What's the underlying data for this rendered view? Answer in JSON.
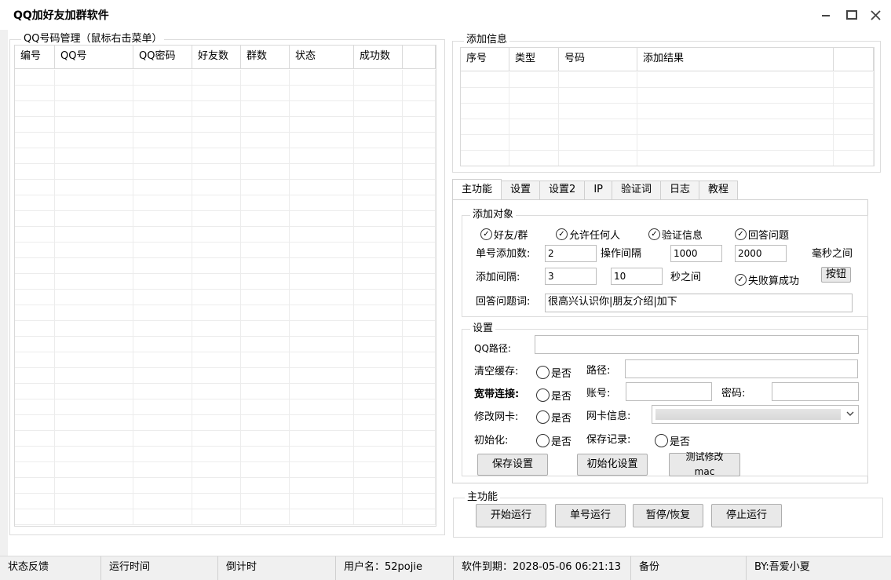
{
  "window": {
    "title": "QQ加好友加群软件"
  },
  "qq_group": {
    "title": "QQ号码管理（鼠标右击菜单）",
    "columns": [
      "编号",
      "QQ号",
      "QQ密码",
      "好友数",
      "群数",
      "状态",
      "成功数"
    ]
  },
  "add_info": {
    "title": "添加信息",
    "columns": [
      "序号",
      "类型",
      "号码",
      "添加结果"
    ]
  },
  "tabs": [
    "主功能",
    "设置",
    "设置2",
    "IP",
    "验证词",
    "日志",
    "教程"
  ],
  "add_target": {
    "title": "添加对象",
    "opt_friend_group": "好友/群",
    "opt_allow_anyone": "允许任何人",
    "opt_verify": "验证信息",
    "opt_answer": "回答问题",
    "single_add_label": "单号添加数:",
    "single_add_value": "2",
    "op_interval_label": "操作间隔",
    "op_interval_min": "1000",
    "op_interval_max": "2000",
    "ms_label": "毫秒之间",
    "add_interval_label": "添加间隔:",
    "add_interval_min": "3",
    "add_interval_max": "10",
    "sec_label": "秒之间",
    "fail_success": "失败算成功",
    "button_label": "按钮",
    "answer_label": "回答问题词:",
    "answer_value": "很高兴认识你|朋友介绍|加下"
  },
  "settings": {
    "title": "设置",
    "qq_path_label": "QQ路径:",
    "clear_cache_label": "清空缓存:",
    "broadband_label": "宽带连接:",
    "modify_nic_label": "修改网卡:",
    "init_label": "初始化:",
    "yes_no": "是否",
    "path_label": "路径:",
    "account_label": "账号:",
    "password_label": "密码:",
    "nic_info_label": "网卡信息:",
    "save_record_label": "保存记录:",
    "save_btn": "保存设置",
    "init_btn": "初始化设置",
    "test_mac_btn_line1": "测试修改",
    "test_mac_btn_line2": "mac"
  },
  "main_func": {
    "title": "主功能",
    "start": "开始运行",
    "single": "单号运行",
    "pause": "暂停/恢复",
    "stop": "停止运行"
  },
  "status_bar": {
    "feedback": "状态反馈",
    "run_time": "运行时间",
    "countdown": "倒计时",
    "username": "用户名：52pojie",
    "expiry": "软件到期：2028-05-06 06:21:13",
    "backup": "备份",
    "by": "BY:吾爱小夏"
  }
}
